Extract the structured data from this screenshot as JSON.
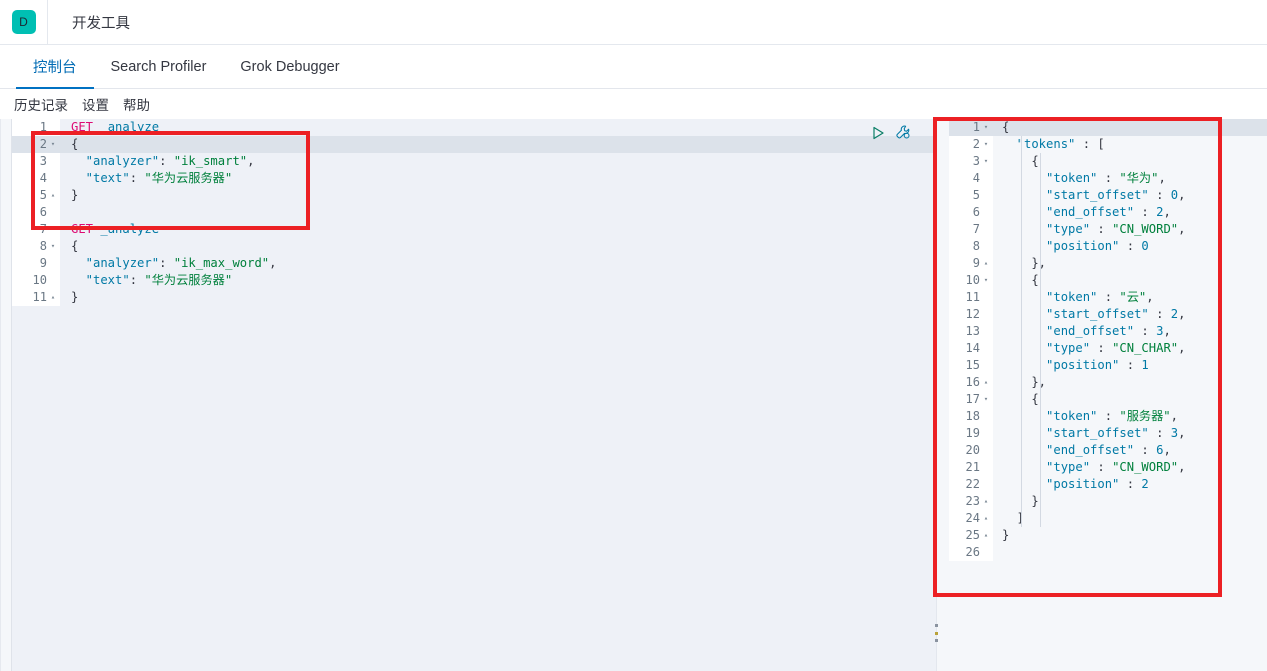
{
  "topbar": {
    "logo_letter": "D",
    "logo_color": "#00bfb3",
    "app_title": "开发工具"
  },
  "tabs": [
    {
      "label": "控制台",
      "active": true
    },
    {
      "label": "Search Profiler",
      "active": false
    },
    {
      "label": "Grok Debugger",
      "active": false
    }
  ],
  "submenu": [
    {
      "label": "历史记录"
    },
    {
      "label": "设置"
    },
    {
      "label": "帮助"
    }
  ],
  "editor_actions": {
    "play_label": "play-request",
    "play_color": "#0a7e66",
    "wrench_label": "wrench-settings",
    "wrench_color": "#0079a5"
  },
  "request_editor": {
    "active_line": 2,
    "lines": [
      {
        "n": "1",
        "fold": "",
        "tokens": [
          {
            "t": "method",
            "v": "GET"
          },
          {
            "t": "plain",
            "v": " "
          },
          {
            "t": "url",
            "v": "_analyze"
          }
        ]
      },
      {
        "n": "2",
        "fold": "▾",
        "tokens": [
          {
            "t": "punc",
            "v": "{"
          }
        ]
      },
      {
        "n": "3",
        "fold": "",
        "tokens": [
          {
            "t": "key",
            "v": "  \"analyzer\""
          },
          {
            "t": "punc",
            "v": ": "
          },
          {
            "t": "str",
            "v": "\"ik_smart\""
          },
          {
            "t": "punc",
            "v": ","
          }
        ]
      },
      {
        "n": "4",
        "fold": "",
        "tokens": [
          {
            "t": "key",
            "v": "  \"text\""
          },
          {
            "t": "punc",
            "v": ": "
          },
          {
            "t": "str",
            "v": "\"华为云服务器\""
          }
        ]
      },
      {
        "n": "5",
        "fold": "▴",
        "tokens": [
          {
            "t": "punc",
            "v": "}"
          }
        ]
      },
      {
        "n": "6",
        "fold": "",
        "tokens": [
          {
            "t": "plain",
            "v": ""
          }
        ]
      },
      {
        "n": "7",
        "fold": "",
        "tokens": [
          {
            "t": "method",
            "v": "GET"
          },
          {
            "t": "plain",
            "v": " "
          },
          {
            "t": "url",
            "v": "_analyze"
          }
        ]
      },
      {
        "n": "8",
        "fold": "▾",
        "tokens": [
          {
            "t": "punc",
            "v": "{"
          }
        ]
      },
      {
        "n": "9",
        "fold": "",
        "tokens": [
          {
            "t": "key",
            "v": "  \"analyzer\""
          },
          {
            "t": "punc",
            "v": ": "
          },
          {
            "t": "str",
            "v": "\"ik_max_word\""
          },
          {
            "t": "punc",
            "v": ","
          }
        ]
      },
      {
        "n": "10",
        "fold": "",
        "tokens": [
          {
            "t": "key",
            "v": "  \"text\""
          },
          {
            "t": "punc",
            "v": ": "
          },
          {
            "t": "str",
            "v": "\"华为云服务器\""
          }
        ]
      },
      {
        "n": "11",
        "fold": "▴",
        "tokens": [
          {
            "t": "punc",
            "v": "}"
          }
        ]
      }
    ]
  },
  "response_editor": {
    "active_line": 1,
    "lines": [
      {
        "n": "1",
        "fold": "▾",
        "tokens": [
          {
            "t": "punc",
            "v": "{"
          }
        ]
      },
      {
        "n": "2",
        "fold": "▾",
        "tokens": [
          {
            "t": "key",
            "v": "  \"tokens\""
          },
          {
            "t": "punc",
            "v": " : ["
          }
        ]
      },
      {
        "n": "3",
        "fold": "▾",
        "tokens": [
          {
            "t": "punc",
            "v": "    {"
          }
        ]
      },
      {
        "n": "4",
        "fold": "",
        "tokens": [
          {
            "t": "key",
            "v": "      \"token\""
          },
          {
            "t": "punc",
            "v": " : "
          },
          {
            "t": "str",
            "v": "\"华为\""
          },
          {
            "t": "punc",
            "v": ","
          }
        ]
      },
      {
        "n": "5",
        "fold": "",
        "tokens": [
          {
            "t": "key",
            "v": "      \"start_offset\""
          },
          {
            "t": "punc",
            "v": " : "
          },
          {
            "t": "num",
            "v": "0"
          },
          {
            "t": "punc",
            "v": ","
          }
        ]
      },
      {
        "n": "6",
        "fold": "",
        "tokens": [
          {
            "t": "key",
            "v": "      \"end_offset\""
          },
          {
            "t": "punc",
            "v": " : "
          },
          {
            "t": "num",
            "v": "2"
          },
          {
            "t": "punc",
            "v": ","
          }
        ]
      },
      {
        "n": "7",
        "fold": "",
        "tokens": [
          {
            "t": "key",
            "v": "      \"type\""
          },
          {
            "t": "punc",
            "v": " : "
          },
          {
            "t": "str",
            "v": "\"CN_WORD\""
          },
          {
            "t": "punc",
            "v": ","
          }
        ]
      },
      {
        "n": "8",
        "fold": "",
        "tokens": [
          {
            "t": "key",
            "v": "      \"position\""
          },
          {
            "t": "punc",
            "v": " : "
          },
          {
            "t": "num",
            "v": "0"
          }
        ]
      },
      {
        "n": "9",
        "fold": "▴",
        "tokens": [
          {
            "t": "punc",
            "v": "    },"
          }
        ]
      },
      {
        "n": "10",
        "fold": "▾",
        "tokens": [
          {
            "t": "punc",
            "v": "    {"
          }
        ]
      },
      {
        "n": "11",
        "fold": "",
        "tokens": [
          {
            "t": "key",
            "v": "      \"token\""
          },
          {
            "t": "punc",
            "v": " : "
          },
          {
            "t": "str",
            "v": "\"云\""
          },
          {
            "t": "punc",
            "v": ","
          }
        ]
      },
      {
        "n": "12",
        "fold": "",
        "tokens": [
          {
            "t": "key",
            "v": "      \"start_offset\""
          },
          {
            "t": "punc",
            "v": " : "
          },
          {
            "t": "num",
            "v": "2"
          },
          {
            "t": "punc",
            "v": ","
          }
        ]
      },
      {
        "n": "13",
        "fold": "",
        "tokens": [
          {
            "t": "key",
            "v": "      \"end_offset\""
          },
          {
            "t": "punc",
            "v": " : "
          },
          {
            "t": "num",
            "v": "3"
          },
          {
            "t": "punc",
            "v": ","
          }
        ]
      },
      {
        "n": "14",
        "fold": "",
        "tokens": [
          {
            "t": "key",
            "v": "      \"type\""
          },
          {
            "t": "punc",
            "v": " : "
          },
          {
            "t": "str",
            "v": "\"CN_CHAR\""
          },
          {
            "t": "punc",
            "v": ","
          }
        ]
      },
      {
        "n": "15",
        "fold": "",
        "tokens": [
          {
            "t": "key",
            "v": "      \"position\""
          },
          {
            "t": "punc",
            "v": " : "
          },
          {
            "t": "num",
            "v": "1"
          }
        ]
      },
      {
        "n": "16",
        "fold": "▴",
        "tokens": [
          {
            "t": "punc",
            "v": "    },"
          }
        ]
      },
      {
        "n": "17",
        "fold": "▾",
        "tokens": [
          {
            "t": "punc",
            "v": "    {"
          }
        ]
      },
      {
        "n": "18",
        "fold": "",
        "tokens": [
          {
            "t": "key",
            "v": "      \"token\""
          },
          {
            "t": "punc",
            "v": " : "
          },
          {
            "t": "str",
            "v": "\"服务器\""
          },
          {
            "t": "punc",
            "v": ","
          }
        ]
      },
      {
        "n": "19",
        "fold": "",
        "tokens": [
          {
            "t": "key",
            "v": "      \"start_offset\""
          },
          {
            "t": "punc",
            "v": " : "
          },
          {
            "t": "num",
            "v": "3"
          },
          {
            "t": "punc",
            "v": ","
          }
        ]
      },
      {
        "n": "20",
        "fold": "",
        "tokens": [
          {
            "t": "key",
            "v": "      \"end_offset\""
          },
          {
            "t": "punc",
            "v": " : "
          },
          {
            "t": "num",
            "v": "6"
          },
          {
            "t": "punc",
            "v": ","
          }
        ]
      },
      {
        "n": "21",
        "fold": "",
        "tokens": [
          {
            "t": "key",
            "v": "      \"type\""
          },
          {
            "t": "punc",
            "v": " : "
          },
          {
            "t": "str",
            "v": "\"CN_WORD\""
          },
          {
            "t": "punc",
            "v": ","
          }
        ]
      },
      {
        "n": "22",
        "fold": "",
        "tokens": [
          {
            "t": "key",
            "v": "      \"position\""
          },
          {
            "t": "punc",
            "v": " : "
          },
          {
            "t": "num",
            "v": "2"
          }
        ]
      },
      {
        "n": "23",
        "fold": "▴",
        "tokens": [
          {
            "t": "punc",
            "v": "    }"
          }
        ]
      },
      {
        "n": "24",
        "fold": "▴",
        "tokens": [
          {
            "t": "punc",
            "v": "  ]"
          }
        ]
      },
      {
        "n": "25",
        "fold": "▴",
        "tokens": [
          {
            "t": "punc",
            "v": "}"
          }
        ]
      },
      {
        "n": "26",
        "fold": "",
        "tokens": [
          {
            "t": "plain",
            "v": ""
          }
        ]
      }
    ]
  },
  "annotations": {
    "color": "#ec2024",
    "boxes": [
      {
        "name": "request-highlight"
      },
      {
        "name": "response-highlight"
      }
    ]
  }
}
